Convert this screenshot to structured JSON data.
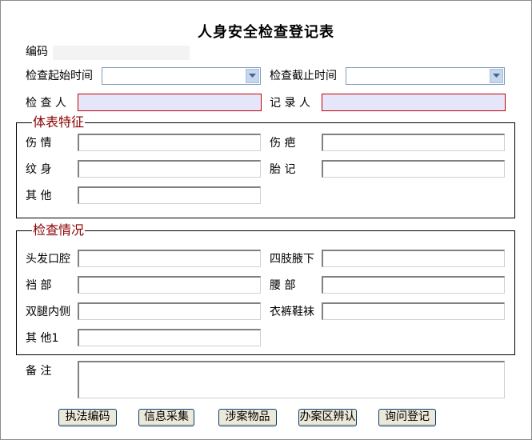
{
  "form": {
    "title": "人身安全检查登记表",
    "code_label": "编码",
    "start_time_label": "检查起始时间",
    "end_time_label": "检查截止时间",
    "inspector_label": "检 查 人",
    "recorder_label": "记 录 人"
  },
  "body_features": {
    "legend": "体表特征",
    "injury_label": "伤    情",
    "scar_label": "伤    疤",
    "tattoo_label": "纹    身",
    "birthmark_label": "胎    记",
    "other_label": "其    他"
  },
  "inspection": {
    "legend": "检查情况",
    "hair_mouth_label": "头发口腔",
    "limbs_armpit_label": "四肢腋下",
    "crotch_label": "裆    部",
    "waist_label": "腰    部",
    "inner_legs_label": "双腿内侧",
    "clothing_label": "衣裤鞋袜",
    "other1_label": "其    他1"
  },
  "remarks": {
    "label": "备    注"
  },
  "buttons": {
    "enforcement_code": "执法编码",
    "info_collection": "信息采集",
    "case_items": "涉案物品",
    "office_area_identify": "办案区辨认",
    "inquiry_register": "询问登记"
  },
  "colors": {
    "required_border": "#c00000",
    "required_fill": "#e6e6fa",
    "legend_text": "#8b0000"
  }
}
